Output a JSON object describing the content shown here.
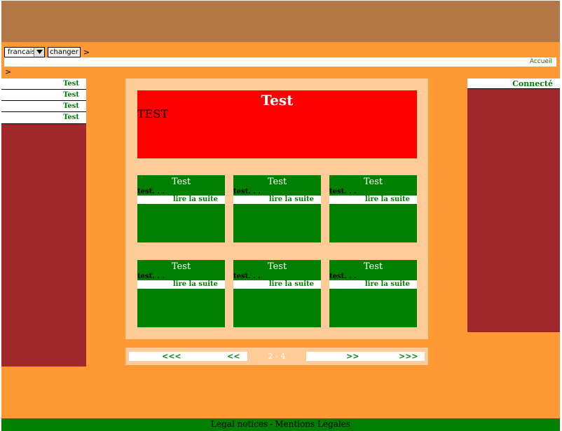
{
  "colors": {
    "page_bg": "#ff9933",
    "banner": "#b27744",
    "side_panel": "#a0282b",
    "content_bg": "#ffcc99",
    "feature_bg": "#ff0000",
    "card_bg": "#008000",
    "link": "#008000"
  },
  "lang": {
    "selected": "francais",
    "change_label": "changer",
    "chevron": ">"
  },
  "topnav": {
    "home_link": "Accueil"
  },
  "breadcrumb": {
    "separator": ">"
  },
  "left_menu": {
    "items": [
      "Test",
      "Test",
      "Test",
      "Test"
    ]
  },
  "right_panel": {
    "status": "Connecté"
  },
  "feature": {
    "title": "Test",
    "body": "TEST"
  },
  "cards": [
    {
      "title": "Test",
      "excerpt": "test. . .",
      "more": "lire la suite"
    },
    {
      "title": "Test",
      "excerpt": "test. . .",
      "more": "lire la suite"
    },
    {
      "title": "Test",
      "excerpt": "test. . .",
      "more": "lire la suite"
    },
    {
      "title": "Test",
      "excerpt": "test. . .",
      "more": "lire la suite"
    },
    {
      "title": "Test",
      "excerpt": "test. . .",
      "more": "lire la suite"
    },
    {
      "title": "Test",
      "excerpt": "test. . .",
      "more": "lire la suite"
    }
  ],
  "pagination": {
    "first": "<<<",
    "prev": "<<",
    "current": "2 - 4",
    "next": ">>",
    "last": ">>>"
  },
  "footer": {
    "legal_notices": "Legal notices",
    "separator": "-",
    "mentions_legales": "Mentions Légales"
  }
}
